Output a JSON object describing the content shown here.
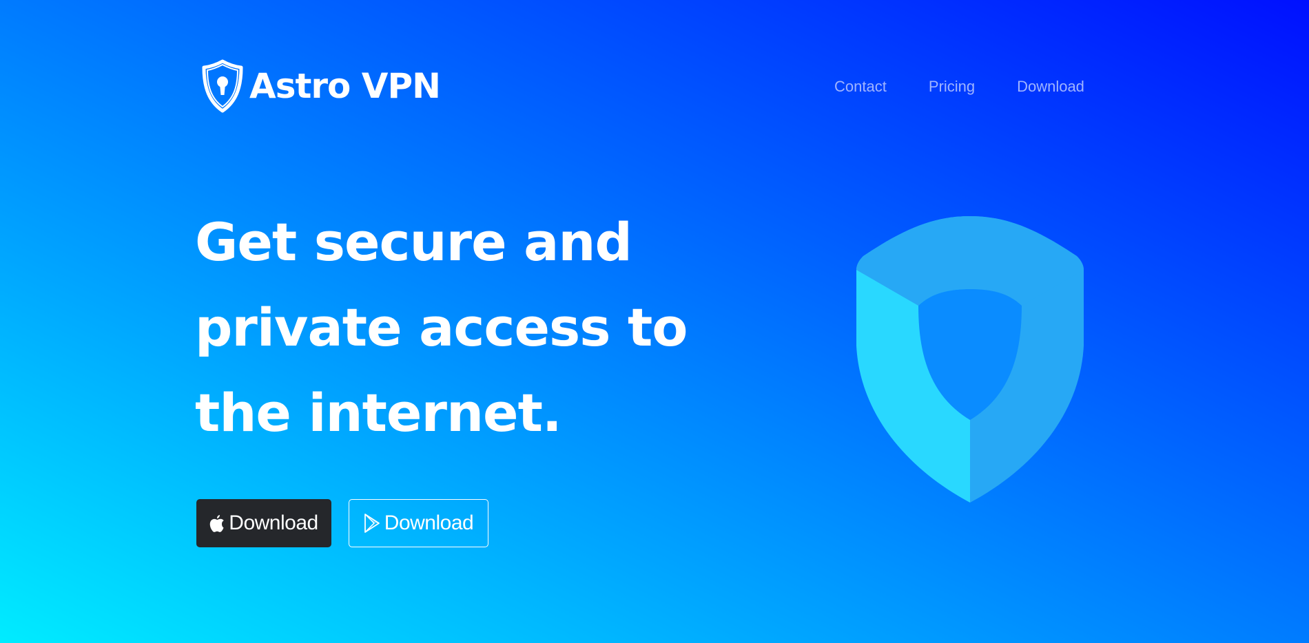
{
  "brand": {
    "name": "Astro VPN",
    "icon": "shield-lock-icon"
  },
  "nav": {
    "links": [
      {
        "label": "Contact"
      },
      {
        "label": "Pricing"
      },
      {
        "label": "Download"
      }
    ]
  },
  "hero": {
    "title": "Get secure and private access to the internet.",
    "buttons": [
      {
        "label": "Download",
        "icon": "apple-icon",
        "style": "dark"
      },
      {
        "label": "Download",
        "icon": "google-play-icon",
        "style": "outline"
      }
    ],
    "illustration": "shield-icon"
  },
  "colors": {
    "gradient_start": "#00ecff",
    "gradient_end": "#0010ff",
    "nav_text": "#9fb4ff",
    "button_dark": "#25272b",
    "shield_light": "#29d8ff",
    "shield_mid": "#27a8f5"
  }
}
